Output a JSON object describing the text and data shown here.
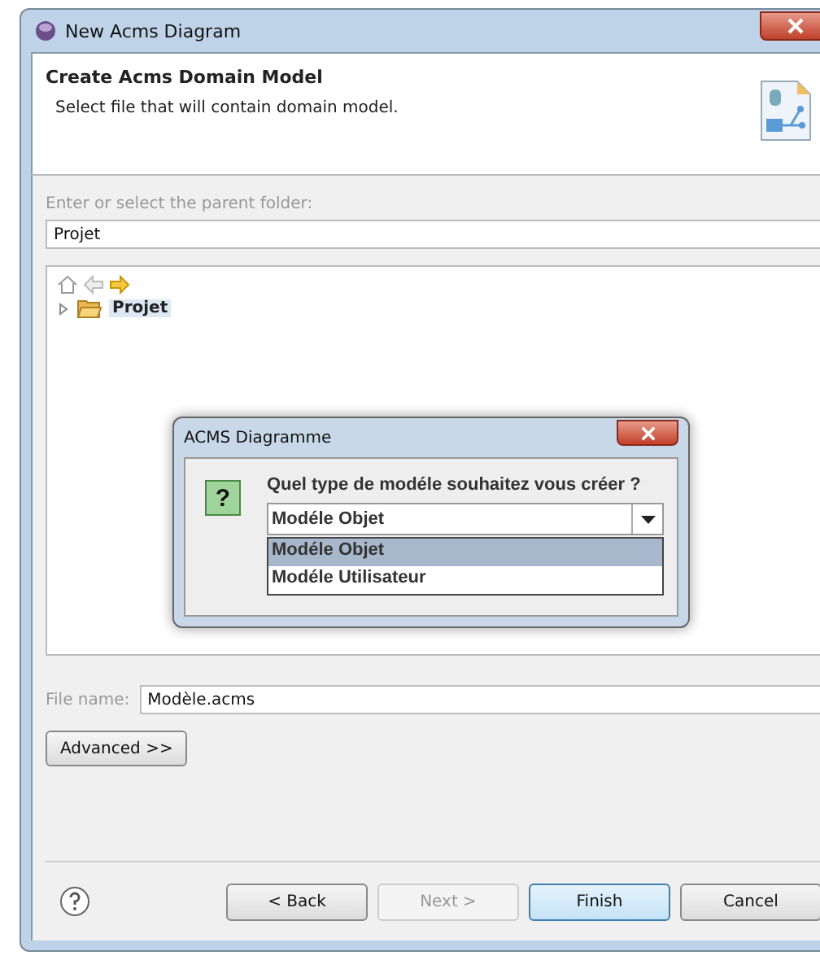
{
  "window": {
    "title": "New Acms Diagram"
  },
  "header": {
    "title": "Create Acms Domain Model",
    "description": "Select file that will contain domain model."
  },
  "folder": {
    "label": "Enter or select the parent folder:",
    "value": "Projet"
  },
  "tree": {
    "items": [
      {
        "label": "Projet",
        "expanded": false,
        "selected": true
      }
    ]
  },
  "dialog": {
    "title": "ACMS Diagramme",
    "icon_glyph": "?",
    "question": "Quel type de modéle souhaitez vous créer ?",
    "combo_value": "Modéle Objet",
    "options": [
      {
        "label": "Modéle Objet",
        "selected": true
      },
      {
        "label": "Modéle Utilisateur",
        "selected": false
      }
    ]
  },
  "file_name": {
    "label": "File name:",
    "value": "Modèle.acms"
  },
  "advanced_button": "Advanced >>",
  "buttons": [
    {
      "label": "< Back",
      "disabled": false,
      "default": false
    },
    {
      "label": "Next >",
      "disabled": true,
      "default": false
    },
    {
      "label": "Finish",
      "disabled": false,
      "default": true
    },
    {
      "label": "Cancel",
      "disabled": false,
      "default": false
    }
  ]
}
